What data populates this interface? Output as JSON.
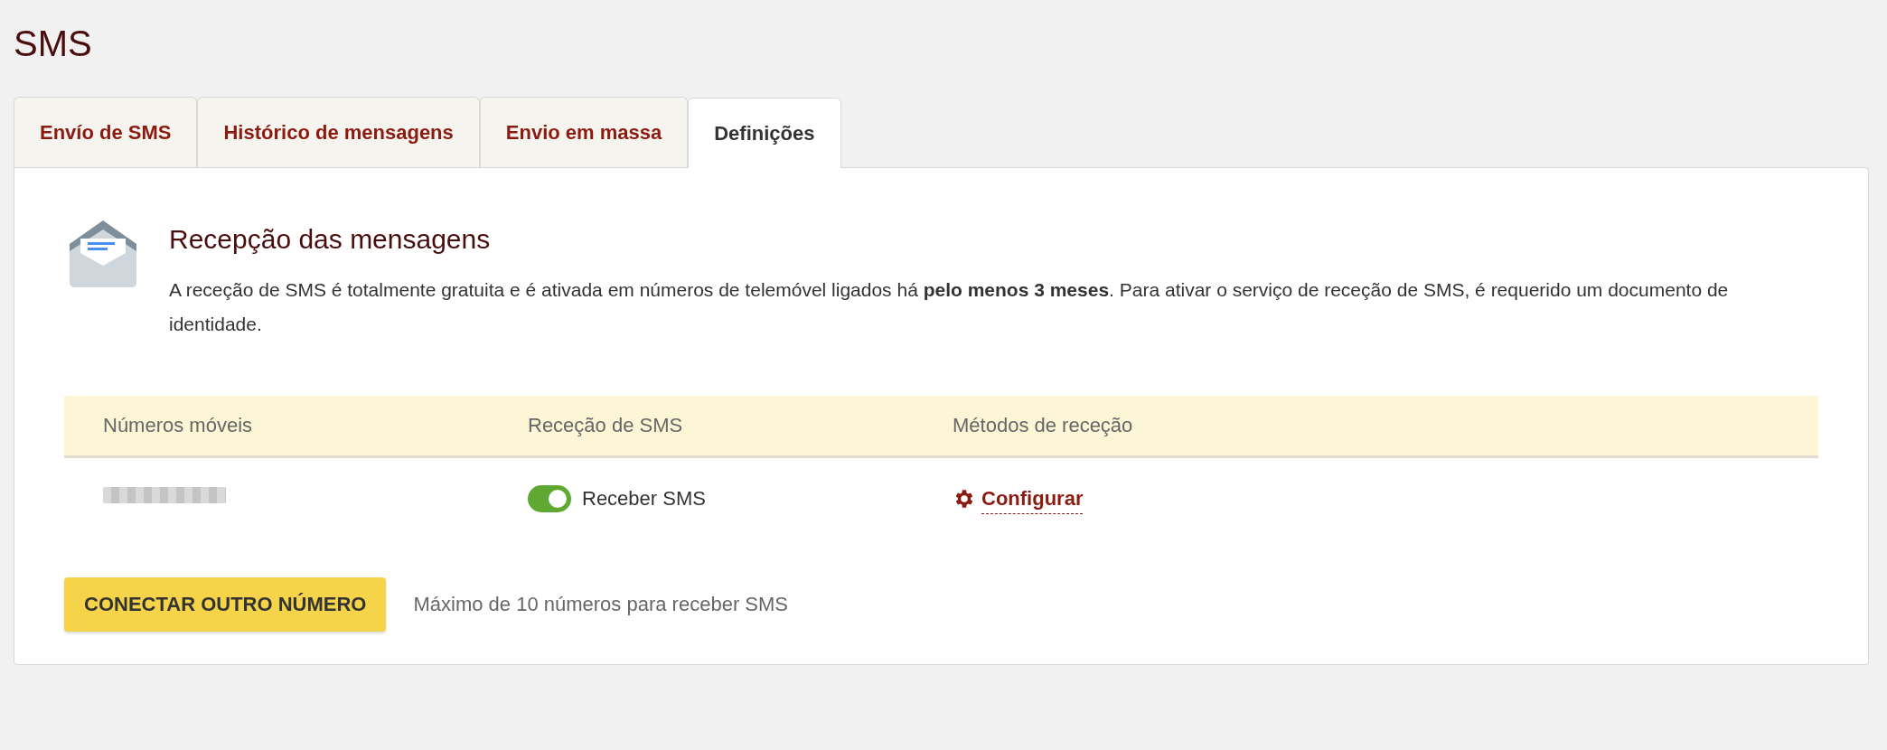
{
  "page_title": "SMS",
  "tabs": [
    {
      "label": "Envío de SMS",
      "selected": false
    },
    {
      "label": "Histórico de mensagens",
      "selected": false
    },
    {
      "label": "Envio em massa",
      "selected": false
    },
    {
      "label": "Definições",
      "selected": true
    }
  ],
  "section": {
    "heading": "Recepção das mensagens",
    "text": "A receção de SMS é totalmente gratuita e é ativada em números de telemóvel ligados há **pelo menos 3 meses**. Para ativar o serviço de receção de SMS, é requerido um documento de identidade."
  },
  "table": {
    "columns": [
      "Números móveis",
      "Receção de SMS",
      "Métodos de receção"
    ],
    "rows": [
      {
        "sms_reception": {
          "label": "Receber SMS",
          "on": true
        },
        "method_link": "Configurar"
      }
    ]
  },
  "connect_button": "CONECTAR OUTRO NÚMERO",
  "limit_note": "Máximo de 10 números para receber SMS"
}
